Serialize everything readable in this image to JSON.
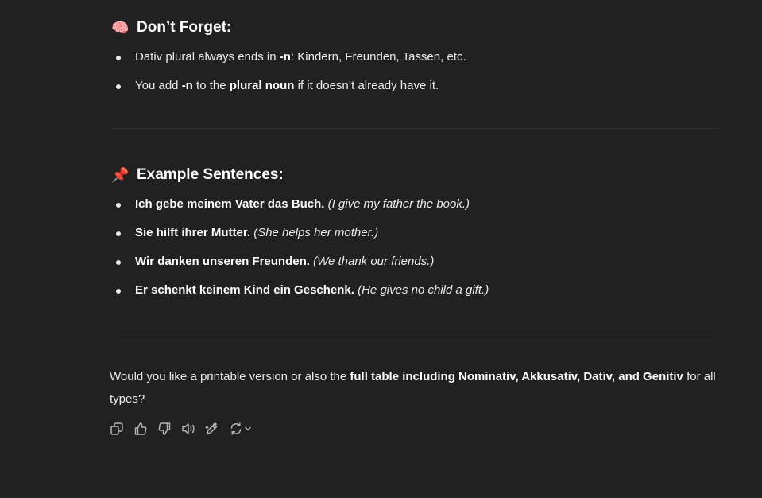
{
  "section1": {
    "emoji": "🧠",
    "title": "Don’t Forget:",
    "items": [
      {
        "t1": "Dativ plural always ends in ",
        "b1": "-n",
        "t2": ": Kindern, Freunden, Tassen, etc."
      },
      {
        "t1": "You add ",
        "b1": "-n",
        "t2": " to the ",
        "b2": "plural noun",
        "t3": " if it doesn’t already have it."
      }
    ]
  },
  "section2": {
    "emoji": "📌",
    "title": "Example Sentences:",
    "items": [
      {
        "german": "Ich gebe meinem Vater das Buch.",
        "english": "(I give my father the book.)"
      },
      {
        "german": "Sie hilft ihrer Mutter.",
        "english": "(She helps her mother.)"
      },
      {
        "german": "Wir danken unseren Freunden.",
        "english": "(We thank our friends.)"
      },
      {
        "german": "Er schenkt keinem Kind ein Geschenk.",
        "english": "(He gives no child a gift.)"
      }
    ]
  },
  "closing": {
    "t1": "Would you like a printable version or also the ",
    "b1": "full table including Nominativ, Akkusativ, Dativ, and Genitiv",
    "t2": " for all types?"
  },
  "actions": {
    "icons": [
      "copy-icon",
      "thumbs-up-icon",
      "thumbs-down-icon",
      "read-aloud-icon",
      "edit-icon",
      "regenerate-icon",
      "chevron-down-icon"
    ]
  },
  "colors": {
    "background": "#212121",
    "text": "#ececec",
    "icon": "#b4b4b4",
    "separator": "#2f2f2f"
  }
}
